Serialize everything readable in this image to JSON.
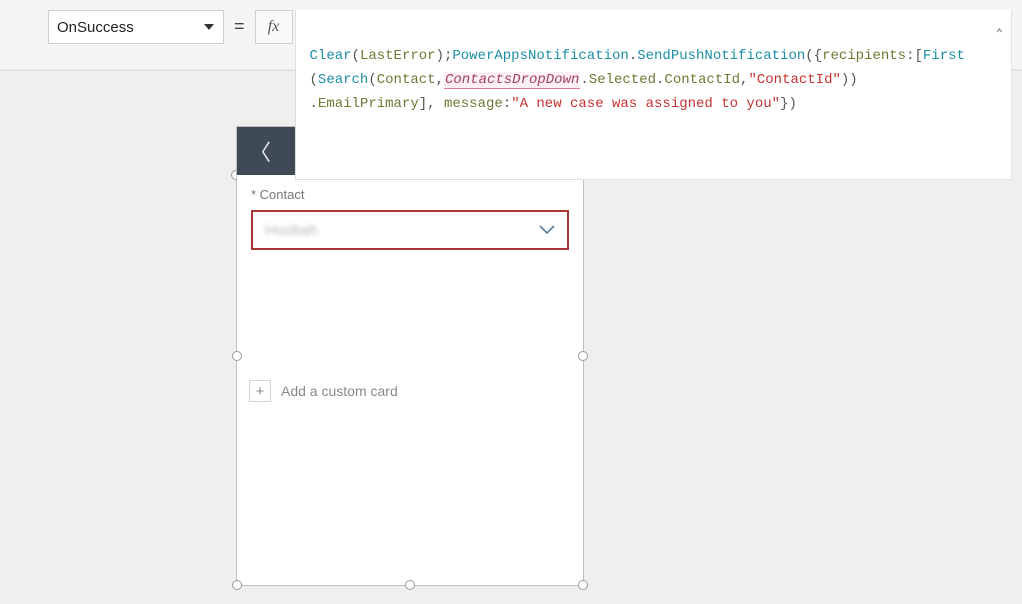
{
  "propertyDropdown": {
    "selected": "OnSuccess"
  },
  "equalsSign": "=",
  "fxLabel": "fx",
  "formula": {
    "tokens": {
      "clear": "Clear",
      "lastError": "LastError",
      "powerApps": "PowerAppsNotification",
      "sendPush": "SendPushNotification",
      "recipients": "recipients",
      "first": "First",
      "search": "Search",
      "contact": "Contact",
      "contactsDropDown": "ContactsDropDown",
      "selected": "Selected",
      "contactId": "ContactId",
      "contactIdStr": "\"ContactId\"",
      "emailPrimary": "EmailPrimary",
      "messageKey": "message",
      "messageVal": "\"A new case was assigned to you\""
    },
    "p": {
      "lp": "(",
      "rp": ")",
      "lb": "[",
      "rb": "]",
      "lc": "{",
      "rc": "}",
      "semi": ";",
      "colon": ":",
      "comma": ",",
      "dot": "."
    }
  },
  "expandChevron": "⌃",
  "canvas": {
    "backIcon": "〈",
    "field": {
      "label": "* Contact",
      "placeholderBlurred": "Hoobah",
      "chevron": "⌄"
    },
    "addCard": {
      "plus": "+",
      "label": "Add a custom card"
    }
  }
}
